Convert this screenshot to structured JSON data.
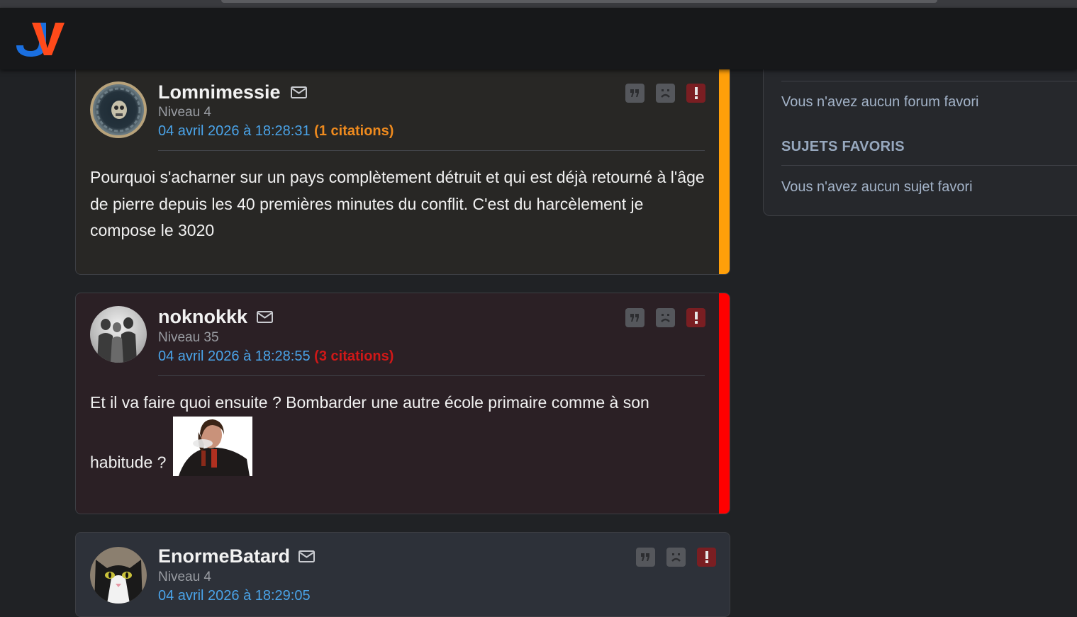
{
  "header": {
    "logo_text": "JV",
    "logo_colors": {
      "j": "#1a6fe0",
      "v": "#ff4a1a"
    }
  },
  "sidebar": {
    "empty_forums": "Vous n'avez aucun forum favori",
    "topics_heading": "SUJETS FAVORIS",
    "empty_topics": "Vous n'avez aucun sujet favori"
  },
  "posts": [
    {
      "author": "Lomnimessie",
      "level": "Niveau 4",
      "date": "04 avril 2026 à 18:28:31",
      "citations": "(1 citations)",
      "citation_color": "#ee8a1e",
      "accent": "#ff9f0a",
      "background": "#282725",
      "message": "Pourquoi s'acharner sur un pays complètement détruit et qui est déjà retourné à l'âge de pierre depuis les 40 premières minutes du conflit. C'est du harcèlement je compose le 3020"
    },
    {
      "author": "noknokkk",
      "level": "Niveau 35",
      "date": "04 avril 2026 à 18:28:55",
      "citations": "(3 citations)",
      "citation_color": "#d01818",
      "accent": "#ff0000",
      "background": "#2b2025",
      "message": "Et il va faire quoi ensuite ? Bombarder une autre école primaire comme à son habitude ?"
    },
    {
      "author": "EnormeBatard",
      "level": "Niveau 4",
      "date": "04 avril 2026 à 18:29:05",
      "background": "#2d3139"
    }
  ],
  "icons": {
    "mail": "mail-icon",
    "quote": "quote-icon",
    "sad": "sad-face-icon",
    "alert": "exclamation-icon"
  }
}
